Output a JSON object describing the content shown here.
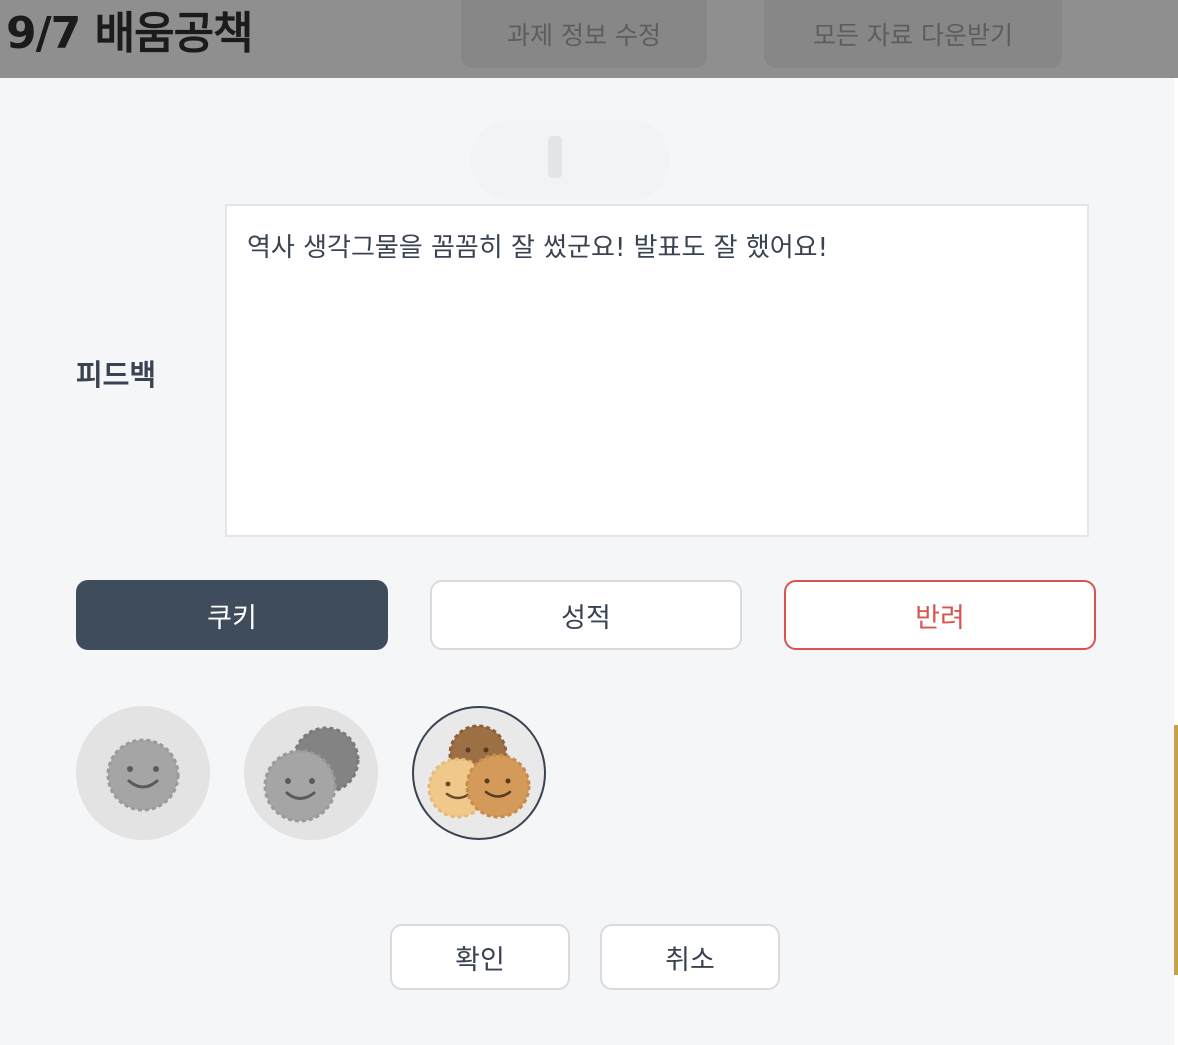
{
  "header": {
    "title": "9/7 배움공책",
    "edit_button": "과제 정보 수정",
    "download_button": "모든 자료 다운받기"
  },
  "feedback": {
    "label": "피드백",
    "text": "역사 생각그물을 꼼꼼히 잘 썼군요! 발표도 잘 했어요!"
  },
  "tabs": [
    {
      "label": "쿠키",
      "selected": true
    },
    {
      "label": "성적",
      "selected": false
    },
    {
      "label": "반려",
      "selected": false
    }
  ],
  "cookie_options": [
    {
      "icon": "one-cookie-icon",
      "count": 1,
      "selected": false
    },
    {
      "icon": "two-cookies-icon",
      "count": 2,
      "selected": false
    },
    {
      "icon": "three-cookies-icon",
      "count": 3,
      "selected": true
    }
  ],
  "actions": {
    "confirm_label": "확인",
    "cancel_label": "취소"
  },
  "colors": {
    "header_overlay": "#8f8f8f",
    "tab_active": "#3f4c5c",
    "reject": "#d9534f",
    "cookie_light": "#f0c98a",
    "cookie_medium": "#d39a5a",
    "cookie_dark": "#9c6f45",
    "cookie_gray": "#a5a5a5"
  }
}
